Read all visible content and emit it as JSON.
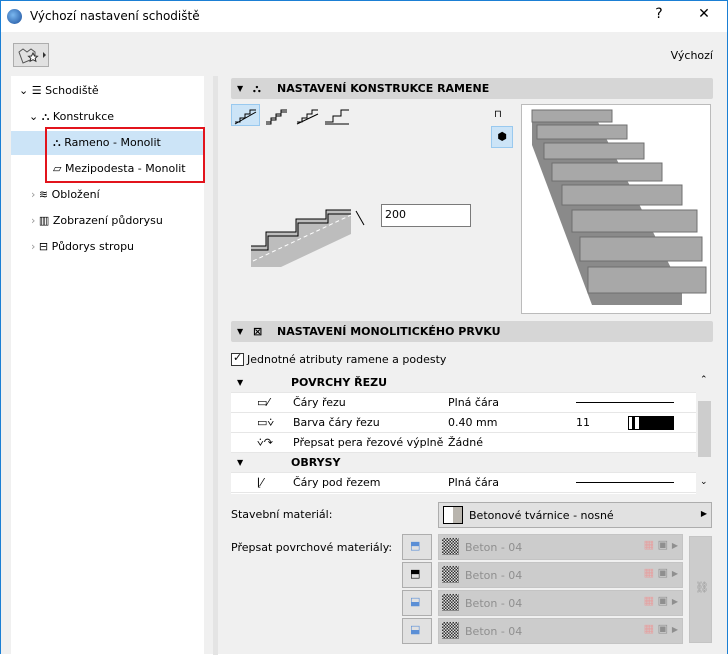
{
  "window": {
    "title": "Výchozí nastavení schodiště",
    "help": "?",
    "close": "✕"
  },
  "toolbar": {
    "preset_label": "Výchozí"
  },
  "tree": [
    {
      "label": "Schodiště",
      "expanded": true
    },
    {
      "label": "Konstrukce",
      "expanded": true
    },
    {
      "label": "Rameno - Monolit",
      "selected": true
    },
    {
      "label": "Mezipodesta - Monolit"
    },
    {
      "label": "Obložení"
    },
    {
      "label": "Zobrazení půdorysu"
    },
    {
      "label": "Půdorys stropu"
    }
  ],
  "section1": {
    "title": "NASTAVENÍ KONSTRUKCE RAMENE",
    "thickness": "200"
  },
  "section2": {
    "title": "NASTAVENÍ MONOLITICKÉHO PRVKU",
    "checkbox_label": "Jednotné atributy ramene a podesty",
    "checked": true
  },
  "table": {
    "group1": "POVRCHY ŘEZU",
    "rows1": [
      {
        "name": "Čáry řezu",
        "value": "Plná čára",
        "extra": ""
      },
      {
        "name": "Barva čáry řezu",
        "value": "0.40 mm",
        "extra": "11"
      },
      {
        "name": "Přepsat pera řezové výplně",
        "value": "Žádné",
        "extra": ""
      }
    ],
    "group2": "OBRYSY",
    "rows2": [
      {
        "name": "Čáry pod řezem",
        "value": "Plná čára"
      }
    ]
  },
  "material": {
    "label": "Stavební materiál:",
    "value": "Betonové tvárnice - nosné"
  },
  "surfaces": {
    "label": "Přepsat povrchové materiály:",
    "items": [
      "Beton - 04",
      "Beton - 04",
      "Beton - 04",
      "Beton - 04"
    ]
  },
  "colors": {
    "accent": "#cce4f7",
    "highlight": "#e2141c",
    "border": "#1b7fd4"
  }
}
